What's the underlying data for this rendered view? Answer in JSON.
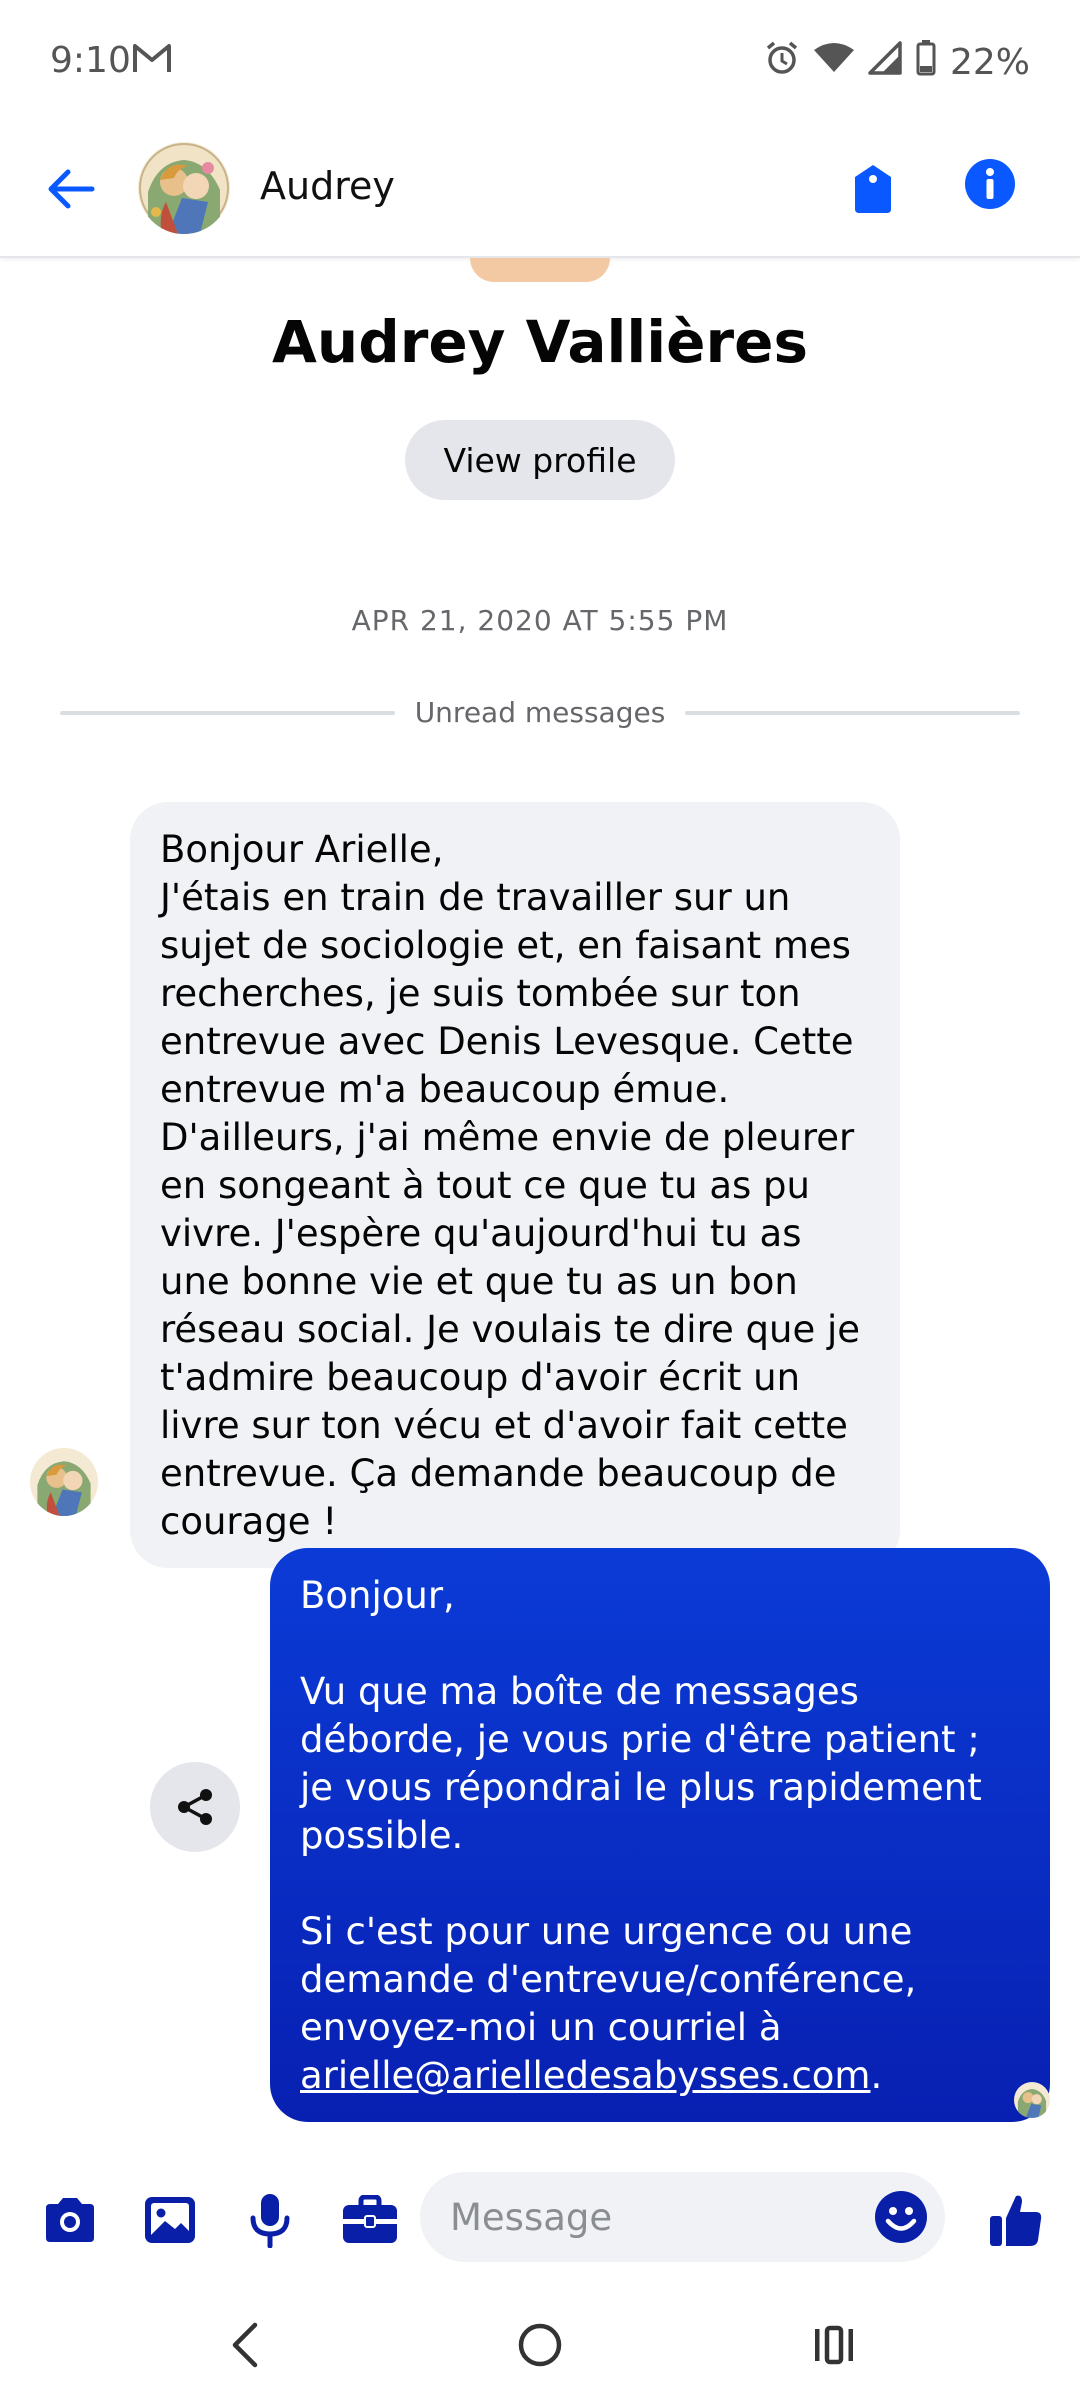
{
  "status_bar": {
    "time": "9:10",
    "battery": "22%",
    "icons": [
      "gmail-icon",
      "alarm-icon",
      "wifi-icon",
      "signal-icon",
      "battery-icon"
    ]
  },
  "header": {
    "contact_name": "Audrey",
    "icons": [
      "back-arrow-icon",
      "tag-icon",
      "info-icon"
    ]
  },
  "profile": {
    "full_name": "Audrey Vallières",
    "view_profile_label": "View profile"
  },
  "conversation": {
    "timestamp": "APR 21, 2020 AT 5:55 PM",
    "unread_label": "Unread messages",
    "incoming_message": "Bonjour Arielle,\nJ'étais en train de travailler sur un sujet de sociologie et, en faisant mes recherches, je suis tombée sur ton entrevue avec Denis Levesque. Cette entrevue m'a beaucoup émue. D'ailleurs, j'ai même envie de pleurer en songeant à tout ce que tu as pu vivre. J'espère qu'aujourd'hui tu as une bonne vie et que tu as un bon réseau social. Je voulais te dire que je t'admire beaucoup d'avoir écrit un livre sur ton vécu et d'avoir fait cette entrevue. Ça demande beaucoup de courage !",
    "outgoing": {
      "greeting": "Bonjour,",
      "para1": "Vu que ma boîte de messages déborde, je vous prie d'être patient ; je vous répondrai le plus rapidement possible.",
      "para2": "Si c'est pour une urgence ou une demande d'entrevue/conférence, envoyez-moi un courriel à",
      "email": "arielle@arielledesabysses.com",
      "trailing": "."
    }
  },
  "composer": {
    "placeholder": "Message",
    "icons": [
      "camera-icon",
      "image-icon",
      "microphone-icon",
      "briefcase-icon",
      "emoji-icon",
      "thumbs-up-icon"
    ]
  },
  "colors": {
    "accent": "#0a58ff",
    "outgoing_bubble": "#0b2fcf",
    "incoming_bubble": "#f0f2f5",
    "icon_blue": "#0a1fa8"
  }
}
